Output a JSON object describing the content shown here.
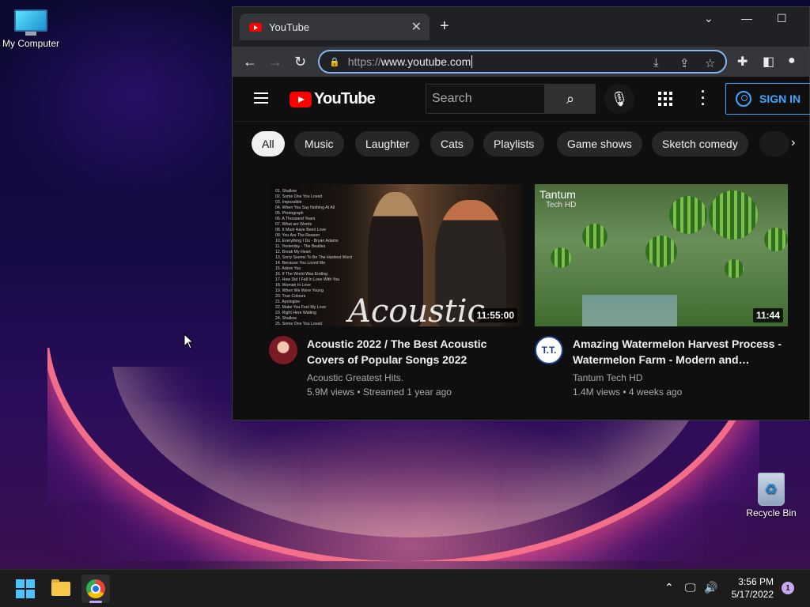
{
  "desktop": {
    "icons": [
      {
        "label": "My Computer",
        "icon": "computer-icon"
      },
      {
        "label": "Recycle Bin",
        "icon": "recycle-bin-icon"
      }
    ]
  },
  "browser": {
    "tab_title": "YouTube",
    "url_scheme": "https://",
    "url_host": "www.youtube.com"
  },
  "youtube": {
    "logo_text": "YouTube",
    "search_placeholder": "Search",
    "sign_in_label": "SIGN IN",
    "chips": [
      "All",
      "Music",
      "Laughter",
      "Cats",
      "Playlists",
      "Game shows",
      "Sketch comedy"
    ],
    "videos": [
      {
        "title": "Acoustic 2022 / The Best Acoustic Covers of Popular Songs 2022",
        "channel": "Acoustic Greatest Hits.",
        "stats": "5.9M views • Streamed 1 year ago",
        "duration": "11:55:00",
        "thumb_text": "Acoustic",
        "tracklist": [
          "01. Shallow",
          "02. Some One You Loved",
          "03. Impossible",
          "04. When You Say Nothing At All",
          "05. Photograph",
          "06. A Thousand Years",
          "07. What are Words",
          "08. It Must Have Been Love",
          "09. You Are The Reason",
          "10. Everything I Do - Bryan Adams",
          "11. Yesterday - The Beatles",
          "12. Break My Heart",
          "13. Sorry Seems To Be The Hardest Word",
          "14. Because You Loved Me",
          "15. Adore You",
          "16. If The World Was Ending",
          "17. How Did I Fall In Love With You",
          "18. Woman In Love",
          "19. When We Were Young",
          "20. True Colours",
          "21. Apologize",
          "22. Make You Feel My Love",
          "23. Right Here Waiting",
          "24. Shallow",
          "25. Some One You Loved"
        ]
      },
      {
        "title": "Amazing Watermelon Harvest Process - Watermelon Farm - Modern and…",
        "channel": "Tantum Tech HD",
        "stats": "1.4M views • 4 weeks ago",
        "duration": "11:44",
        "thumb_brand": "Tantum",
        "thumb_brand_sub": "Tech HD",
        "avatar_text": "T.T."
      }
    ]
  },
  "taskbar": {
    "time": "3:56 PM",
    "date": "5/17/2022",
    "notification_count": "1"
  }
}
